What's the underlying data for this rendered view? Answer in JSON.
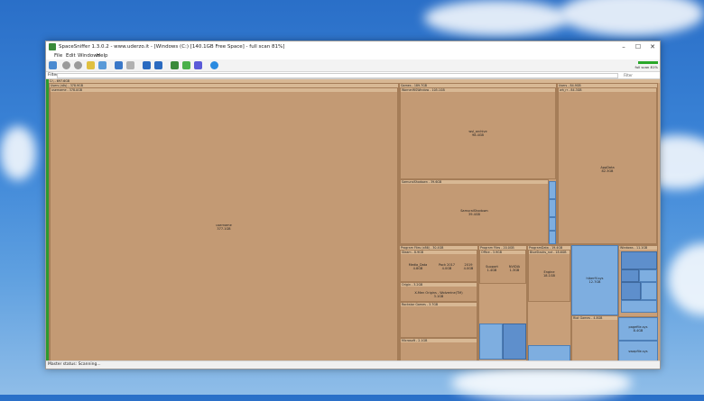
{
  "window": {
    "title": "SpaceSniffer 1.3.0.2 - www.uderzo.it - [Windows (C:) [140.1GB Free Space] - full scan 81%]",
    "minimize": "–",
    "maximize": "☐",
    "close": "✕"
  },
  "menu": [
    "File",
    "Edit",
    "Windows",
    "Help"
  ],
  "filter": {
    "label": "Filter",
    "hint": "Filter",
    "scan_label": "full scan 81%"
  },
  "status": "Master status: Scanning...",
  "map": {
    "root": "C:\\ - 697.6GB",
    "users_all": "Users (alls) - 378.9GB",
    "username": "username - 378.0GB",
    "username_center": "username",
    "username_size": "377.1GB",
    "games": "Games - 189.7GB",
    "wsl": "WarnerWSWindow - 105.1GB",
    "wsl_file": "wsl_archive",
    "wsl_size": "98.4GB",
    "sw_outer": "SamuraiShodown - 39.6GB",
    "sw_inner": "SamuraiShodown",
    "sw_size": "39.4GB",
    "users2": "Users - 84.9GB",
    "appdata_hdr": "wh_rr - 84.3GB",
    "appdata": "AppData",
    "appdata_size": "82.3GB",
    "program_files_x86": "Program Files (x86) - 30.4GB",
    "steam": "Steam - 8.9GB",
    "media_data": "Media_Data",
    "media_data_size": "4.8GB",
    "pack_2017": "Pack 2017",
    "pack_size": "4.0GB",
    "g2019": "2019",
    "g2019_size": "4.0GB",
    "origin": "Origin - 3.2GB",
    "xbox_origins": "X-Men Origins - Wolverine(TM)",
    "xbox_size": "3.1GB",
    "rockstar": "Rockstar Games - 3.7GB",
    "program_files": "Program Files - 20.0GB",
    "office": "Office - 3.9GB",
    "support": "Support",
    "support_size": "1.4GB",
    "nvidia": "NVIDIA",
    "nvidia_size": "1.3GB",
    "program_data": "ProgramData - 19.4GB",
    "bluestacks": "BlueStacks_nxt - 18.6GB",
    "engine": "Engine",
    "engine_size": "18.1GB",
    "hiberfil": "hiberfil.sys",
    "hiberfil_size": "12.7GB",
    "pagefile": "pagefile.sys",
    "pagefile_size": "8.4GB",
    "swapfile": "swapfile.sys",
    "windows": "Windows - 11.1GB",
    "riot": "Riot Games - 4.8GB",
    "microsoft": "Microsoft - 2.1GB"
  },
  "colors": {
    "folder": "#c89f79",
    "file_blue": "#7eaee0",
    "scan_green": "#2e9a2e"
  }
}
